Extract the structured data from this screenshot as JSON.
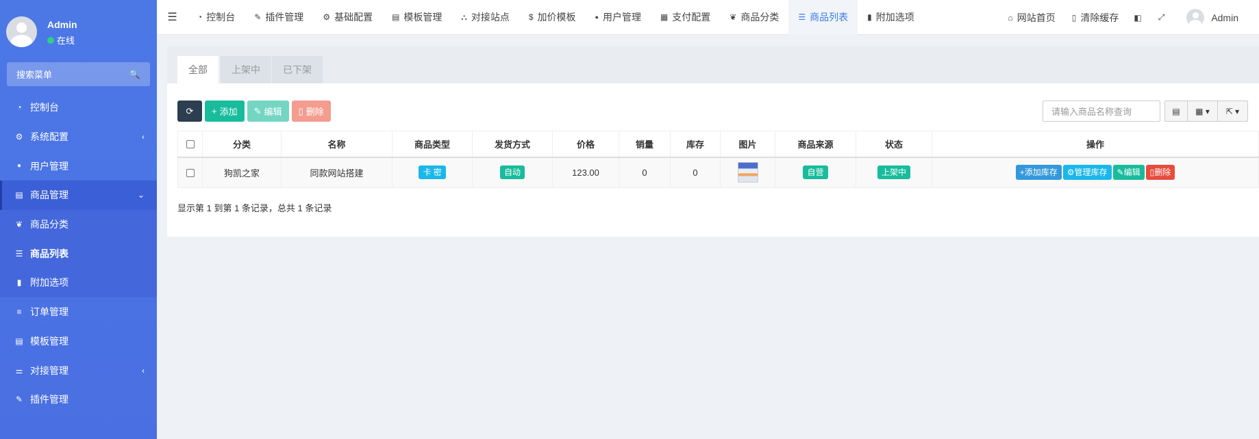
{
  "sidebar": {
    "user": {
      "name": "Admin",
      "status": "在线"
    },
    "search_placeholder": "搜索菜单",
    "items": [
      {
        "label": "控制台",
        "icon": "dashboard-icon",
        "glyph": "◔"
      },
      {
        "label": "系统配置",
        "icon": "gear-icon",
        "glyph": "⚙",
        "arrow": "‹"
      },
      {
        "label": "用户管理",
        "icon": "user-icon",
        "glyph": "👤"
      },
      {
        "label": "商品管理",
        "icon": "cart-icon",
        "glyph": "🛒",
        "arrow": "⌄"
      },
      {
        "label": "商品分类",
        "icon": "leaf-icon",
        "glyph": "❦"
      },
      {
        "label": "商品列表",
        "icon": "list-icon",
        "glyph": "☰"
      },
      {
        "label": "附加选项",
        "icon": "bookmark-icon",
        "glyph": "🔖"
      },
      {
        "label": "订单管理",
        "icon": "menu-icon",
        "glyph": "≡"
      },
      {
        "label": "模板管理",
        "icon": "template-icon",
        "glyph": "▤"
      },
      {
        "label": "对接管理",
        "icon": "sliders-icon",
        "glyph": "⚌",
        "arrow": "‹"
      },
      {
        "label": "插件管理",
        "icon": "plug-icon",
        "glyph": "✎"
      }
    ]
  },
  "topbar": {
    "items": [
      {
        "label": "控制台",
        "glyph": "◔"
      },
      {
        "label": "插件管理",
        "glyph": "✎"
      },
      {
        "label": "基础配置",
        "glyph": "⚙"
      },
      {
        "label": "模板管理",
        "glyph": "▤"
      },
      {
        "label": "对接站点",
        "glyph": "⛬"
      },
      {
        "label": "加价模板",
        "glyph": "$"
      },
      {
        "label": "用户管理",
        "glyph": "👤"
      },
      {
        "label": "支付配置",
        "glyph": "▦"
      },
      {
        "label": "商品分类",
        "glyph": "❦"
      },
      {
        "label": "商品列表",
        "glyph": "☰"
      },
      {
        "label": "附加选项",
        "glyph": "🔖"
      }
    ],
    "right": {
      "home": "网站首页",
      "clear_cache": "清除缓存",
      "user": "Admin"
    }
  },
  "content": {
    "tabs": [
      "全部",
      "上架中",
      "已下架"
    ],
    "buttons": {
      "add": "添加",
      "edit": "编辑",
      "delete": "删除"
    },
    "search_placeholder": "请输入商品名称查询",
    "table": {
      "headers": [
        "分类",
        "名称",
        "商品类型",
        "发货方式",
        "价格",
        "销量",
        "库存",
        "图片",
        "商品来源",
        "状态",
        "操作"
      ],
      "rows": [
        {
          "category": "狗凯之家",
          "name": "同款网站搭建",
          "type": "卡 密",
          "delivery": "自动",
          "price": "123.00",
          "sales": "0",
          "stock": "0",
          "source": "自营",
          "status": "上架中",
          "ops": [
            "添加库存",
            "管理库存",
            "编辑",
            "删除"
          ]
        }
      ]
    },
    "pager_info": "显示第 1 到第 1 条记录，总共 1 条记录"
  }
}
